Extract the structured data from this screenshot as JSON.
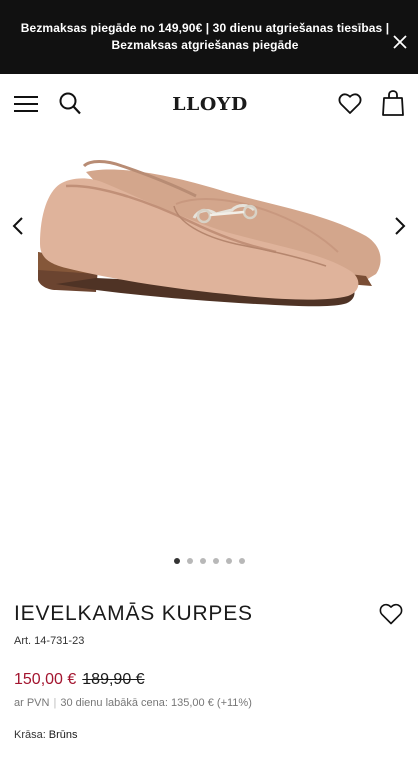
{
  "banner": {
    "text": "Bezmaksas piegāde no 149,90€ | 30 dienu atgriešanas tiesības | Bezmaksas atgriešanas piegāde",
    "close_icon": "close-icon"
  },
  "header": {
    "logo": "LLOYD",
    "icons": [
      "hamburger-menu-icon",
      "search-icon",
      "heart-icon",
      "shopping-bag-icon"
    ]
  },
  "gallery": {
    "image_count": 6,
    "active_index": 0,
    "icons": [
      "chevron-left-icon",
      "chevron-right-icon"
    ]
  },
  "product": {
    "title": "IEVELKAMĀS KURPES",
    "article": "Art. 14-731-23",
    "price_current": "150,00 €",
    "price_original": "189,90 €",
    "vat_note": "ar PVN",
    "lowest_price_note": "30 dienu labākā cena: 135,00 € (+11%)",
    "color_label": "Krāsa:",
    "color_value": "Brūns"
  },
  "colors": {
    "banner_bg": "#111111",
    "sale_price": "#a3152f",
    "shoe_suede": "#d9ab92"
  }
}
